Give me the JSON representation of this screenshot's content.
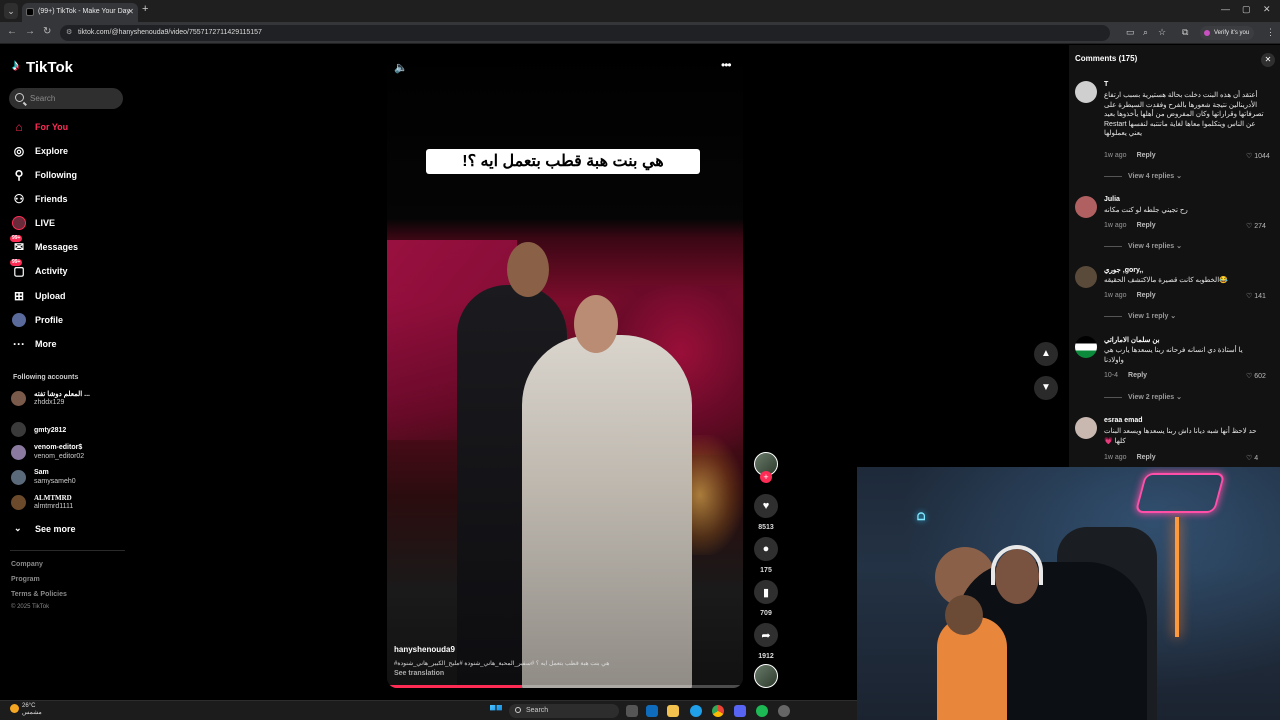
{
  "browser": {
    "tab_title": "(99+) TikTok - Make Your Day",
    "url": "tiktok.com/@hanyshenouda9/video/7557172711429115157",
    "verify_label": "Verify it's you"
  },
  "sidebar": {
    "logo": "TikTok",
    "search_placeholder": "Search",
    "nav": [
      {
        "label": "For You",
        "icon": "home-icon"
      },
      {
        "label": "Explore",
        "icon": "compass-icon"
      },
      {
        "label": "Following",
        "icon": "person-add-icon"
      },
      {
        "label": "Friends",
        "icon": "friends-icon"
      },
      {
        "label": "LIVE",
        "icon": "live-icon"
      },
      {
        "label": "Messages",
        "icon": "messages-icon",
        "badge": "99+"
      },
      {
        "label": "Activity",
        "icon": "activity-icon",
        "badge": "99+"
      },
      {
        "label": "Upload",
        "icon": "upload-icon"
      },
      {
        "label": "Profile",
        "icon": "profile-icon"
      },
      {
        "label": "More",
        "icon": "more-icon"
      }
    ],
    "following_title": "Following accounts",
    "following": [
      {
        "name": "المعلم دوشا تفته ...",
        "handle": "zhddx129"
      },
      {
        "name": "gmty2812",
        "handle": ""
      },
      {
        "name": "venom-editor$",
        "handle": "venom_editor02"
      },
      {
        "name": "Sam",
        "handle": "samysameh0"
      },
      {
        "name": "ALMTMRD",
        "handle": "almtmrd1111"
      }
    ],
    "see_more": "See more",
    "footer": [
      "Company",
      "Program",
      "Terms & Policies"
    ],
    "copyright": "© 2025 TikTok"
  },
  "video": {
    "caption": "هي بنت هبة قطب بتعمل ايه ؟!",
    "username": "hanyshenouda9",
    "description": "#هي بنت هبة قطب بتعمل ايه ؟ #سفير_المحبة_هاني_شنودة #مليح_الكبير_هاني_شنودة",
    "see_translation": "See translation",
    "progress": 0.38
  },
  "actions": {
    "likes": "8513",
    "comments": "175",
    "saves": "709",
    "shares": "1912"
  },
  "comments_panel": {
    "title": "Comments (175)",
    "items": [
      {
        "user": "T",
        "text": "أعتقد أن هذه البنت دخلت بحالة هستيرية بسبب ارتفاع الأدرينالين نتيجة شعورها بالفرح وفقدت السيطرة على تصرفاتها وقراراتها وكان المفروض من أهلها يأخذوها بعيد عن الناس ويتكلموا معاها لغاية ماتنتبه لنفسها Restart يعني يعملولها",
        "time": "1w ago",
        "reply": "Reply",
        "likes": "1044",
        "replies": "View 4 replies"
      },
      {
        "user": "Julia",
        "text": "رح تجيني جلطه لو كنت مكانه",
        "time": "1w ago",
        "reply": "Reply",
        "likes": "274",
        "replies": "View 4 replies"
      },
      {
        "user": "جوري ,gory,,",
        "text": "😂الخطوبه كانت قصيرة مالاكتشف الحقيقه",
        "time": "1w ago",
        "reply": "Reply",
        "likes": "141",
        "replies": "View 1 reply"
      },
      {
        "user": "بن سلمان الاماراتي",
        "text": "يا أستاذة دي انسانه فرحانه ربنا يسعدها يارب هي واولادنا",
        "time": "10-4",
        "reply": "Reply",
        "likes": "602",
        "replies": "View 2 replies"
      },
      {
        "user": "esraa emad",
        "text": "حد لاحظ أنها شبه ديانا داش ربنا يسعدها ويسعد البنات كلها 💗",
        "time": "1w ago",
        "reply": "Reply",
        "likes": "4",
        "replies": ""
      }
    ]
  },
  "webcam": {
    "neon_sign": "ᗝ"
  },
  "taskbar": {
    "temperature": "26°C",
    "weather_text": "مشمس",
    "search": "Search"
  }
}
